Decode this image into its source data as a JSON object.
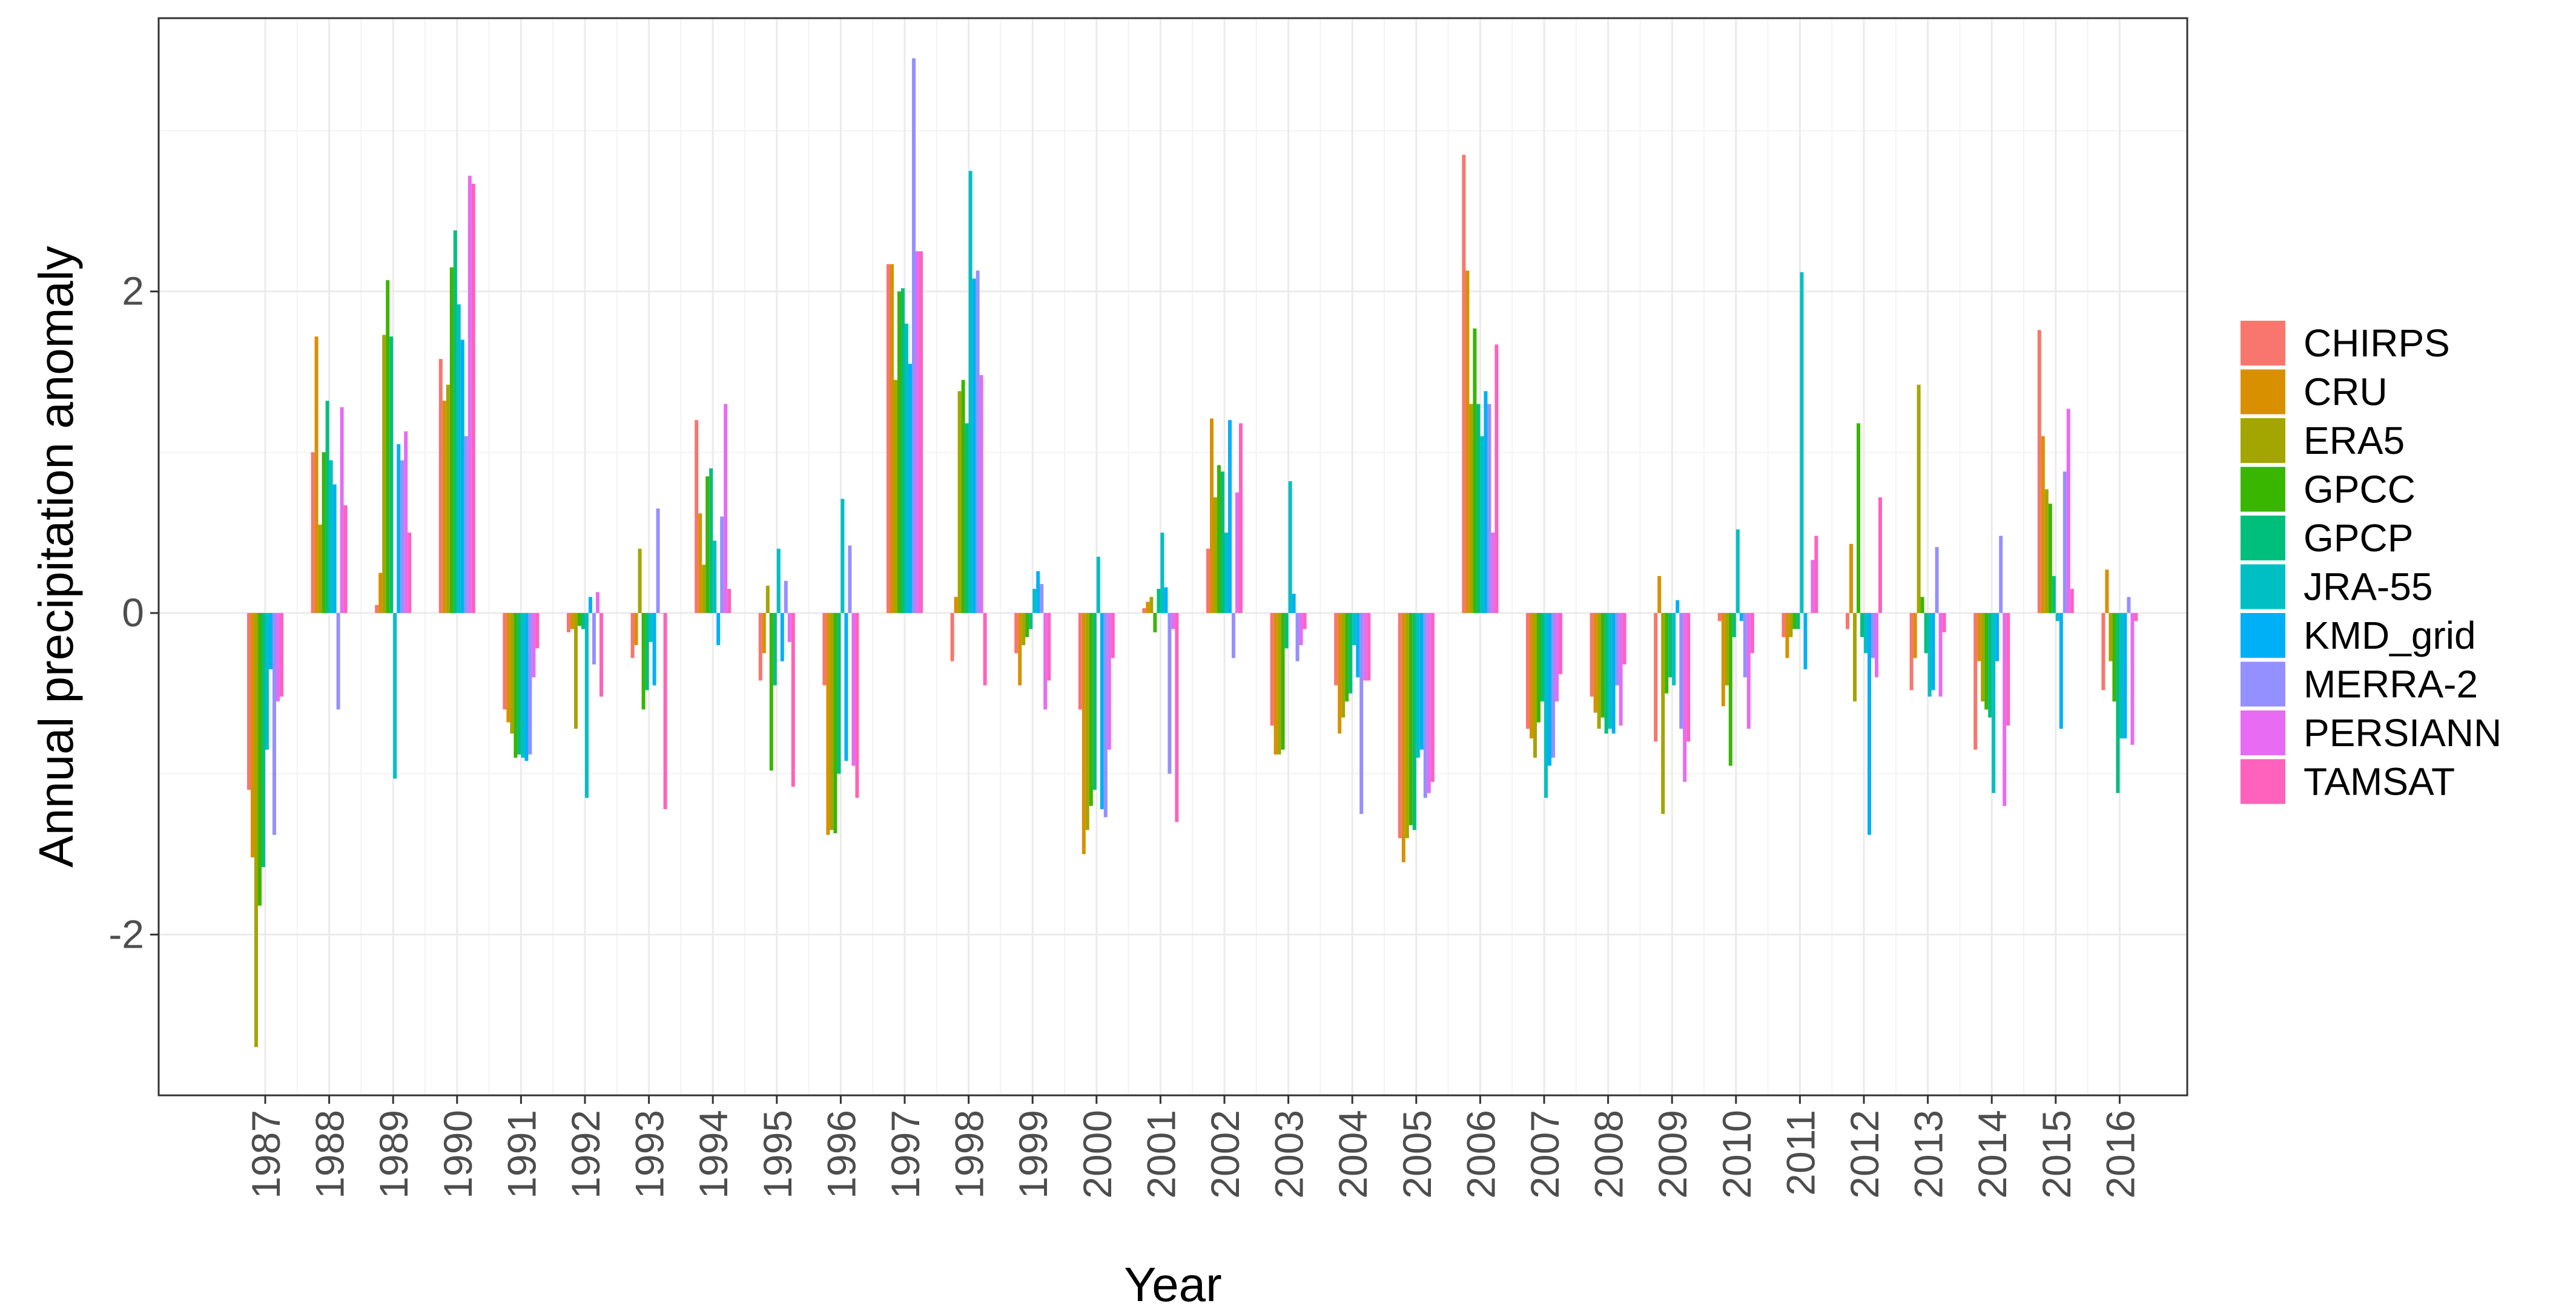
{
  "chart_data": {
    "type": "bar",
    "xlabel": "Year",
    "ylabel": "Annual precipitation anomaly",
    "ylim": [
      -3.0,
      3.7
    ],
    "yticks": [
      -2,
      0,
      2
    ],
    "ytick_labels": [
      "-2",
      "0",
      "2"
    ],
    "grid": true,
    "legend_position": "right",
    "categories": [
      "1987",
      "1988",
      "1989",
      "1990",
      "1991",
      "1992",
      "1993",
      "1994",
      "1995",
      "1996",
      "1997",
      "1998",
      "1999",
      "2000",
      "2001",
      "2002",
      "2003",
      "2004",
      "2005",
      "2006",
      "2007",
      "2008",
      "2009",
      "2010",
      "2011",
      "2012",
      "2013",
      "2014",
      "2015",
      "2016"
    ],
    "series": [
      {
        "name": "CHIRPS",
        "color": "#F8766D",
        "values": [
          -1.1,
          1.0,
          0.05,
          1.58,
          -0.6,
          -0.12,
          -0.28,
          1.2,
          -0.42,
          -0.45,
          2.17,
          -0.3,
          -0.25,
          -0.6,
          0.03,
          0.4,
          -0.7,
          -0.45,
          -1.4,
          2.85,
          -0.72,
          -0.52,
          -0.8,
          -0.05,
          -0.15,
          -0.1,
          -0.48,
          -0.85,
          1.76,
          -0.48
        ]
      },
      {
        "name": "CRU",
        "color": "#D89000",
        "values": [
          -1.52,
          1.72,
          0.25,
          1.32,
          -0.68,
          -0.1,
          -0.2,
          0.62,
          -0.25,
          -1.38,
          2.17,
          0.1,
          -0.45,
          -1.5,
          0.07,
          1.21,
          -0.88,
          -0.75,
          -1.55,
          2.13,
          -0.78,
          -0.62,
          0.23,
          -0.58,
          -0.28,
          0.43,
          -0.28,
          -0.3,
          1.1,
          0.27
        ]
      },
      {
        "name": "ERA5",
        "color": "#A3A500",
        "values": [
          -2.7,
          0.55,
          1.73,
          1.42,
          -0.75,
          -0.72,
          0.4,
          0.3,
          0.17,
          -1.35,
          1.45,
          1.38,
          -0.2,
          -1.35,
          0.1,
          0.72,
          -0.88,
          -0.65,
          -1.4,
          1.3,
          -0.9,
          -0.72,
          -1.25,
          -0.45,
          -0.15,
          -0.55,
          1.42,
          -0.55,
          0.77,
          -0.3
        ]
      },
      {
        "name": "GPCC",
        "color": "#39B600",
        "values": [
          -1.82,
          1.0,
          2.07,
          2.15,
          -0.9,
          -0.08,
          -0.6,
          0.85,
          -0.98,
          -1.37,
          2.0,
          1.45,
          -0.15,
          -1.2,
          -0.12,
          0.92,
          -0.85,
          -0.55,
          -1.32,
          1.77,
          -0.68,
          -0.65,
          -0.5,
          -0.95,
          -0.1,
          1.18,
          0.1,
          -0.6,
          0.68,
          -0.55
        ]
      },
      {
        "name": "GPCP",
        "color": "#00BF7D",
        "values": [
          -1.58,
          1.32,
          1.72,
          2.38,
          -0.88,
          -0.1,
          -0.48,
          0.9,
          -0.45,
          -1.0,
          2.02,
          1.18,
          -0.1,
          -1.1,
          0.15,
          0.88,
          -0.22,
          -0.5,
          -1.35,
          1.3,
          -0.55,
          -0.75,
          -0.4,
          -0.15,
          -0.1,
          -0.15,
          -0.25,
          -0.65,
          0.23,
          -1.12
        ]
      },
      {
        "name": "JRA-55",
        "color": "#00BFC4",
        "values": [
          -0.85,
          0.95,
          -1.03,
          1.92,
          -0.9,
          -1.15,
          -0.18,
          0.45,
          0.4,
          0.71,
          1.8,
          2.75,
          0.15,
          0.35,
          0.5,
          0.5,
          0.82,
          -0.2,
          -0.9,
          1.1,
          -1.15,
          -0.72,
          -0.45,
          0.52,
          2.12,
          -0.25,
          -0.52,
          -1.12,
          -0.05,
          -0.78
        ]
      },
      {
        "name": "KMD_grid",
        "color": "#00B0F6",
        "values": [
          -0.35,
          0.8,
          1.05,
          1.7,
          -0.92,
          0.1,
          -0.45,
          -0.2,
          -0.3,
          -0.92,
          1.55,
          2.08,
          0.26,
          -1.22,
          0.16,
          1.2,
          0.12,
          -0.4,
          -0.85,
          1.38,
          -0.95,
          -0.75,
          0.08,
          -0.05,
          -0.35,
          -1.38,
          -0.48,
          -0.3,
          -0.72,
          -0.78
        ]
      },
      {
        "name": "MERRA-2",
        "color": "#9590FF",
        "values": [
          -1.38,
          -0.6,
          0.95,
          1.1,
          -0.88,
          -0.32,
          0.65,
          0.6,
          0.2,
          0.42,
          3.45,
          2.13,
          0.18,
          -1.27,
          -1.0,
          -0.28,
          -0.3,
          -1.25,
          -1.15,
          1.3,
          -0.9,
          -0.45,
          -0.72,
          -0.4,
          0.0,
          -0.28,
          0.41,
          0.48,
          0.88,
          0.1
        ]
      },
      {
        "name": "PERSIANN",
        "color": "#E76BF3",
        "values": [
          -0.55,
          1.28,
          1.13,
          2.72,
          -0.4,
          0.13,
          0.0,
          1.3,
          -0.18,
          -0.95,
          2.25,
          1.48,
          -0.6,
          -0.85,
          -0.1,
          0.75,
          -0.2,
          -0.42,
          -1.12,
          0.5,
          -0.55,
          -0.7,
          -1.05,
          -0.72,
          0.33,
          -0.4,
          -0.52,
          -1.2,
          1.27,
          -0.82
        ]
      },
      {
        "name": "TAMSAT",
        "color": "#FF62BC",
        "values": [
          -0.52,
          0.67,
          0.5,
          2.67,
          -0.22,
          -0.52,
          -1.22,
          0.15,
          -1.08,
          -1.15,
          2.25,
          -0.45,
          -0.42,
          -0.28,
          -1.3,
          1.18,
          -0.1,
          -0.42,
          -1.05,
          1.67,
          -0.38,
          -0.32,
          -0.8,
          -0.25,
          0.48,
          0.72,
          -0.12,
          -0.7,
          0.15,
          -0.05
        ]
      }
    ]
  }
}
